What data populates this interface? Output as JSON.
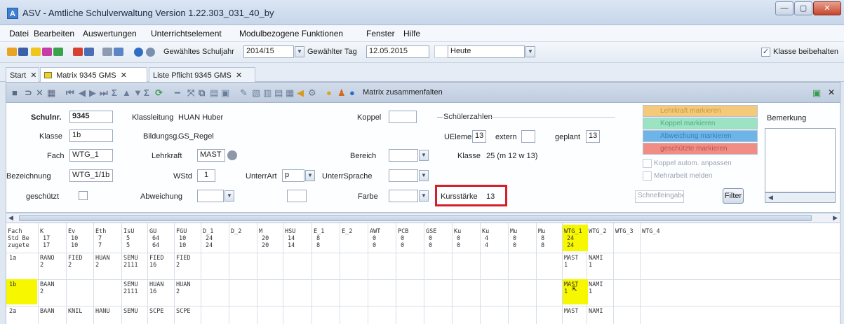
{
  "window": {
    "title": "ASV - Amtliche Schulverwaltung Version 1.22.303_031_40_by",
    "app_icon": "A",
    "minimize": "—",
    "maximize": "▢",
    "close": "✕"
  },
  "menu": [
    "Datei",
    "Bearbeiten",
    "Auswertungen",
    "Unterrichtselement",
    "Modulbezogene Funktionen",
    "Fenster",
    "Hilfe"
  ],
  "toolbar": {
    "schuljahr_label": "Gewähltes Schuljahr",
    "schuljahr_value": "2014/15",
    "tag_label": "Gewählter Tag",
    "tag_value": "12.05.2015",
    "heute_value": "Heute",
    "klasse_label": "Klasse beibehalten",
    "klasse_checked": "✓"
  },
  "tabs": [
    {
      "label": "Start"
    },
    {
      "label": "Matrix 9345 GMS"
    },
    {
      "label": "Liste Pflicht 9345 GMS"
    }
  ],
  "tab_close": "✕",
  "toolbar2": {
    "matrix_button": "Matrix zusammenfalten",
    "close": "✕"
  },
  "form": {
    "schulnr_label": "Schulnr.",
    "schulnr_value": "9345",
    "klasse_label": "Klasse",
    "klasse_value": "1b",
    "fach_label": "Fach",
    "fach_value": "WTG_1",
    "bezeichnung_label": "Bezeichnung",
    "bezeichnung_value": "WTG_1/1b",
    "geschuetzt_label": "geschützt",
    "klassleitung_label": "Klassleitung",
    "klassleitung_value": "HUAN Huber",
    "bildungsg_label": "Bildungsg.",
    "bildungsg_value": "GS_Regel",
    "lehrkraft_label": "Lehrkraft",
    "lehrkraft_value": "MAST",
    "wstd_label": "WStd",
    "wstd_value": "1",
    "unterrart_label": "UnterrArt",
    "unterrart_value": "p",
    "abweichung_label": "Abweichung",
    "koppel_label": "Koppel",
    "bereich_label": "Bereich",
    "unterrsprache_label": "UnterrSprache",
    "farbe_label": "Farbe",
    "schuelerzahlen_label": "Schülerzahlen",
    "uelement_label": "UElement",
    "uelement_value": "13",
    "extern_label": "extern",
    "geplant_label": "geplant",
    "geplant_value": "13",
    "klasse2_label": "Klasse",
    "klasse2_value": "25 (m 12 w 13)",
    "kursstaerke_label": "Kursstärke",
    "kursstaerke_value": "13"
  },
  "legend": {
    "lehrkraft": "Lehrkraft markieren",
    "koppel": "Koppel markieren",
    "abweichung": "Abweichung markieren",
    "geschuetzt": "geschützte markieren",
    "koppel_auto": "Koppel autom. anpassen",
    "mehrarbeit": "Mehrarbeit melden",
    "schnelleingabe": "Schnelleingabe",
    "filter": "Filter",
    "bemerkung_label": "Bemerkung"
  },
  "colors": {
    "accent_yellow": "#f7f700",
    "highlight_red": "#d3202a",
    "lehrkraft": "#f5c97a",
    "koppel": "#9be3c2",
    "abweichung": "#6db4e9",
    "geschuetzt": "#f08e85"
  },
  "grid": {
    "row_labels": [
      "Fach",
      "Std Be",
      "zugete"
    ],
    "columns": [
      {
        "name": "K",
        "v1": "17",
        "v2": "17"
      },
      {
        "name": "Ev",
        "v1": "10",
        "v2": "10"
      },
      {
        "name": "Eth",
        "v1": "7",
        "v2": "7"
      },
      {
        "name": "IsU",
        "v1": "5",
        "v2": "5"
      },
      {
        "name": "GU",
        "v1": "64",
        "v2": "64"
      },
      {
        "name": "FGU",
        "v1": "10",
        "v2": "10"
      },
      {
        "name": "D_1",
        "v1": "24",
        "v2": "24"
      },
      {
        "name": "D_2",
        "v1": "",
        "v2": ""
      },
      {
        "name": "M",
        "v1": "20",
        "v2": "20"
      },
      {
        "name": "HSU",
        "v1": "14",
        "v2": "14"
      },
      {
        "name": "E_1",
        "v1": "8",
        "v2": "8"
      },
      {
        "name": "E_2",
        "v1": "",
        "v2": ""
      },
      {
        "name": "AWT",
        "v1": "0",
        "v2": "0"
      },
      {
        "name": "PCB",
        "v1": "0",
        "v2": "0"
      },
      {
        "name": "GSE",
        "v1": "0",
        "v2": "0"
      },
      {
        "name": "Ku",
        "v1": "0",
        "v2": "0"
      },
      {
        "name": "Ku",
        "v1": "4",
        "v2": "4"
      },
      {
        "name": "Mu",
        "v1": "0",
        "v2": "0"
      },
      {
        "name": "Mu",
        "v1": "8",
        "v2": "8"
      },
      {
        "name": "WTG_1",
        "v1": "24",
        "v2": "24"
      },
      {
        "name": "WTG_2",
        "v1": "",
        "v2": ""
      },
      {
        "name": "WTG_3",
        "v1": "",
        "v2": ""
      },
      {
        "name": "WTG_4",
        "v1": "",
        "v2": ""
      }
    ],
    "rows": [
      {
        "klasse": "1a",
        "cells": [
          [
            "RANO",
            "2"
          ],
          [
            "FIED",
            "2"
          ],
          [
            "HUAN",
            "2"
          ],
          [
            "SEMU",
            "2111"
          ],
          [
            "FIED",
            "16"
          ],
          [
            "FIED",
            "2"
          ],
          [
            "",
            ""
          ],
          [
            "",
            ""
          ],
          [
            "",
            ""
          ],
          [
            "",
            ""
          ],
          [
            "",
            ""
          ],
          [
            "",
            ""
          ],
          [
            "",
            ""
          ],
          [
            "",
            ""
          ],
          [
            "",
            ""
          ],
          [
            "",
            ""
          ],
          [
            "",
            ""
          ],
          [
            "",
            ""
          ],
          [
            "",
            ""
          ],
          [
            "MAST",
            "1"
          ],
          [
            "NAMI",
            "1"
          ]
        ]
      },
      {
        "klasse": "1b",
        "cells": [
          [
            "BAAN",
            "2"
          ],
          [
            "",
            ""
          ],
          [
            "",
            ""
          ],
          [
            "SEMU",
            "2111"
          ],
          [
            "HUAN",
            "16"
          ],
          [
            "HUAN",
            "2"
          ],
          [
            "",
            ""
          ],
          [
            "",
            ""
          ],
          [
            "",
            ""
          ],
          [
            "",
            ""
          ],
          [
            "",
            ""
          ],
          [
            "",
            ""
          ],
          [
            "",
            ""
          ],
          [
            "",
            ""
          ],
          [
            "",
            ""
          ],
          [
            "",
            ""
          ],
          [
            "",
            ""
          ],
          [
            "",
            ""
          ],
          [
            "",
            ""
          ],
          [
            "MAST",
            "1"
          ],
          [
            "NAMI",
            "1"
          ]
        ]
      },
      {
        "klasse": "2a",
        "cells": [
          [
            "BAAN",
            ""
          ],
          [
            "KNIL",
            ""
          ],
          [
            "HANU",
            ""
          ],
          [
            "SEMU",
            ""
          ],
          [
            "SCPE",
            ""
          ],
          [
            "SCPE",
            ""
          ],
          [
            "",
            ""
          ],
          [
            "",
            ""
          ],
          [
            "",
            ""
          ],
          [
            "",
            ""
          ],
          [
            "",
            ""
          ],
          [
            "",
            ""
          ],
          [
            "",
            ""
          ],
          [
            "",
            ""
          ],
          [
            "",
            ""
          ],
          [
            "",
            ""
          ],
          [
            "",
            ""
          ],
          [
            "",
            ""
          ],
          [
            "",
            ""
          ],
          [
            "MAST",
            ""
          ],
          [
            "NAMI",
            ""
          ]
        ]
      }
    ]
  }
}
